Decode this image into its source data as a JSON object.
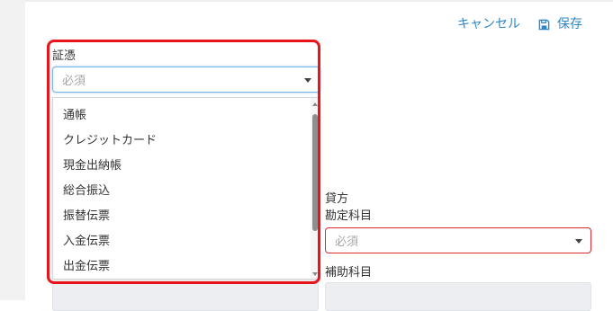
{
  "header": {
    "cancel_label": "キャンセル",
    "save_label": "保存",
    "save_icon": "floppy-disk-icon"
  },
  "voucher": {
    "label": "証憑",
    "placeholder": "必須",
    "options": [
      "通帳",
      "クレジットカード",
      "現金出納帳",
      "総合振込",
      "振替伝票",
      "入金伝票",
      "出金伝票"
    ]
  },
  "credit": {
    "section_label": "貸方",
    "account_label": "勘定科目",
    "account_placeholder": "必須",
    "sub_account_label": "補助科目"
  },
  "colors": {
    "accent": "#2f86c6",
    "error": "#e0282f",
    "highlight": "#e8141c"
  }
}
